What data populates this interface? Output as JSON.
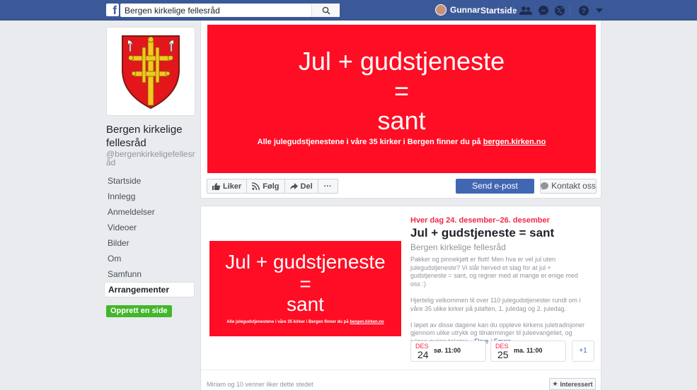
{
  "topbar": {
    "logo": "f",
    "search_value": "Bergen kirkelige fellesråd",
    "user_name": "Gunnar",
    "home_label": "Startside",
    "icons": [
      "friends-icon",
      "messenger-icon",
      "globe-icon",
      "help-icon",
      "dropdown-icon"
    ],
    "brand_color": "#3b5998"
  },
  "page": {
    "name": "Bergen kirkelige fellesråd",
    "handle": "@bergenkirkeligefellesråd"
  },
  "nav": {
    "items": [
      {
        "label": "Startside"
      },
      {
        "label": "Innlegg"
      },
      {
        "label": "Anmeldelser"
      },
      {
        "label": "Videoer"
      },
      {
        "label": "Bilder"
      },
      {
        "label": "Om"
      },
      {
        "label": "Samfunn"
      },
      {
        "label": "Arrangementer"
      }
    ],
    "active": "Arrangementer",
    "create_page_label": "Opprett en side"
  },
  "cover": {
    "line1": "Jul + gudstjeneste",
    "line2": "=",
    "line3": "sant",
    "subtitle_prefix": "Alle julegudstjenestene i våre 35 kirker i Bergen finner du på ",
    "subtitle_link": "bergen.kirken.no",
    "bg_color": "#ff0d24"
  },
  "actions": {
    "like": "Liker",
    "follow": "Følg",
    "share": "Del",
    "more": "···",
    "send_email": "Send e-post",
    "contact": "Kontakt oss"
  },
  "event": {
    "date_range": "Hver dag 24. desember–26. desember",
    "title": "Jul + gudstjeneste = sant",
    "host": "Bergen kirkelige fellesråd",
    "desc1": "Pakker og pinnekjøtt er flott! Men hva er vel jul uten julegudstjeneste? Vi slår herved et slag for at jul + gudstjeneste = sant, og regner med at mange er enige med oss :)",
    "desc2": "Hjertelig velkommen til over 110 julegudstjenester rundt om i våre 35 ulike kirker på julaften, 1. juledag og 2. juledag.",
    "desc3": "I løpet av disse dagene kan du oppleve kirkens juletradisjoner gjennom ulike utrykk og tilnærminger til juleevangeliet, og julens øvrige tekster...",
    "more_link": "Flere",
    "less_link": "Færre",
    "dates": [
      {
        "month": "DES",
        "day": "24",
        "time": "sø. 11:00"
      },
      {
        "month": "DES",
        "day": "25",
        "time": "ma. 11:00"
      }
    ],
    "more_dates": "+1",
    "friends_text": "Miriam og 10 venner liker dette stedet",
    "interested_label": "Interessert"
  }
}
